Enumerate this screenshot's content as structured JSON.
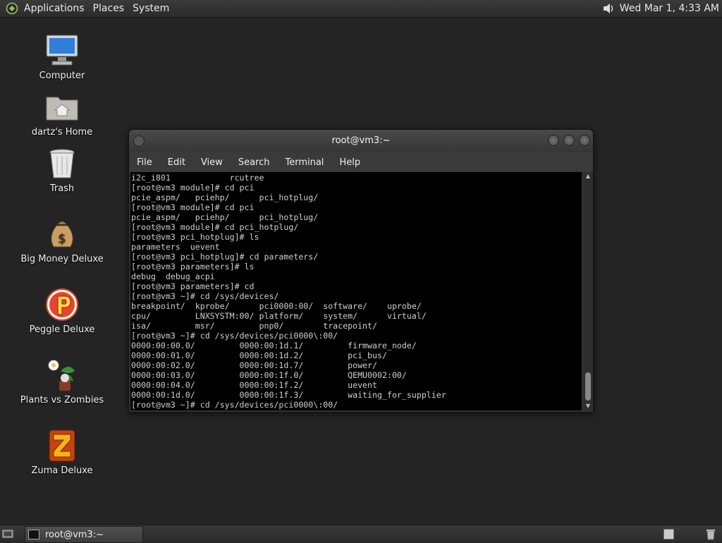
{
  "top_panel": {
    "menus": [
      "Applications",
      "Places",
      "System"
    ],
    "clock": "Wed Mar  1,  4:33 AM"
  },
  "desktop_icons": [
    {
      "label": "Computer",
      "icon": "computer-icon"
    },
    {
      "label": "dartz's Home",
      "icon": "home-folder-icon"
    },
    {
      "label": "Trash",
      "icon": "trash-icon"
    },
    {
      "label": "Big Money Deluxe",
      "icon": "money-bag-icon"
    },
    {
      "label": "Peggle Deluxe",
      "icon": "peggle-icon"
    },
    {
      "label": "Plants vs Zombies",
      "icon": "plants-vs-zombies-icon"
    },
    {
      "label": "Zuma Deluxe",
      "icon": "zuma-icon"
    }
  ],
  "terminal": {
    "title": "root@vm3:~",
    "menu": [
      "File",
      "Edit",
      "View",
      "Search",
      "Terminal",
      "Help"
    ],
    "lines": [
      "i2c_i801            rcutree",
      "[root@vm3 module]# cd pci",
      "pcie_aspm/   pciehp/      pci_hotplug/",
      "[root@vm3 module]# cd pci",
      "pcie_aspm/   pciehp/      pci_hotplug/",
      "[root@vm3 module]# cd pci_hotplug/",
      "[root@vm3 pci_hotplug]# ls",
      "parameters  uevent",
      "[root@vm3 pci_hotplug]# cd parameters/",
      "[root@vm3 parameters]# ls",
      "debug  debug_acpi",
      "[root@vm3 parameters]# cd",
      "[root@vm3 ~]# cd /sys/devices/",
      "breakpoint/  kprobe/      pci0000:00/  software/    uprobe/",
      "cpu/         LNXSYSTM:00/ platform/    system/      virtual/",
      "isa/         msr/         pnp0/        tracepoint/",
      "[root@vm3 ~]# cd /sys/devices/pci0000\\:00/",
      "0000:00:00.0/         0000:00:1d.1/         firmware_node/",
      "0000:00:01.0/         0000:00:1d.2/         pci_bus/",
      "0000:00:02.0/         0000:00:1d.7/         power/",
      "0000:00:03.0/         0000:00:1f.0/         QEMU0002:00/",
      "0000:00:04.0/         0000:00:1f.2/         uevent",
      "0000:00:1d.0/         0000:00:1f.3/         waiting_for_supplier",
      "[root@vm3 ~]# cd /sys/devices/pci0000\\:00/"
    ]
  },
  "taskbar": {
    "task_label": "root@vm3:~"
  }
}
